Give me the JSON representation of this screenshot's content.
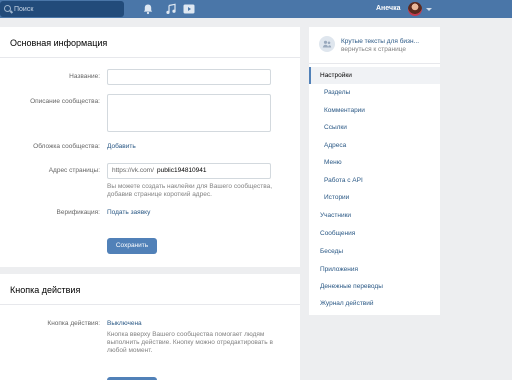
{
  "header": {
    "search_placeholder": "Поиск",
    "user_name": "Анечка"
  },
  "basic_info": {
    "title": "Основная информация",
    "name_label": "Название:",
    "description_label": "Описание сообщества:",
    "cover_label": "Обложка сообщества:",
    "cover_action": "Добавить",
    "address_label": "Адрес страницы:",
    "address_prefix": "https://vk.com/",
    "address_value": "public194810941",
    "address_hint": "Вы можете создать наклейки для Вашего сообщества, добавив странице короткий адрес.",
    "verification_label": "Верификация:",
    "verification_action": "Подать заявку",
    "save_label": "Сохранить"
  },
  "action_button": {
    "title": "Кнопка действия",
    "label": "Кнопка действия:",
    "value": "Выключена",
    "hint": "Кнопка вверху Вашего сообщества помогает людям выполнить действие. Кнопку можно отредактировать в любой момент."
  },
  "sidebar": {
    "back_title": "Крутые тексты для бизн...",
    "back_subtitle": "вернуться к странице",
    "items": [
      {
        "label": "Настройки",
        "active": true
      },
      {
        "label": "Разделы"
      },
      {
        "label": "Комментарии"
      },
      {
        "label": "Ссылки"
      },
      {
        "label": "Адреса"
      },
      {
        "label": "Меню"
      },
      {
        "label": "Работа с API"
      },
      {
        "label": "Истории"
      },
      {
        "label": "Участники"
      },
      {
        "label": "Сообщения"
      },
      {
        "label": "Беседы"
      },
      {
        "label": "Приложения"
      },
      {
        "label": "Денежные переводы"
      },
      {
        "label": "Журнал действий"
      }
    ]
  },
  "colors": {
    "header": "#4a76a8",
    "accent": "#5181b8",
    "link": "#2a5885",
    "background": "#edeef0"
  }
}
